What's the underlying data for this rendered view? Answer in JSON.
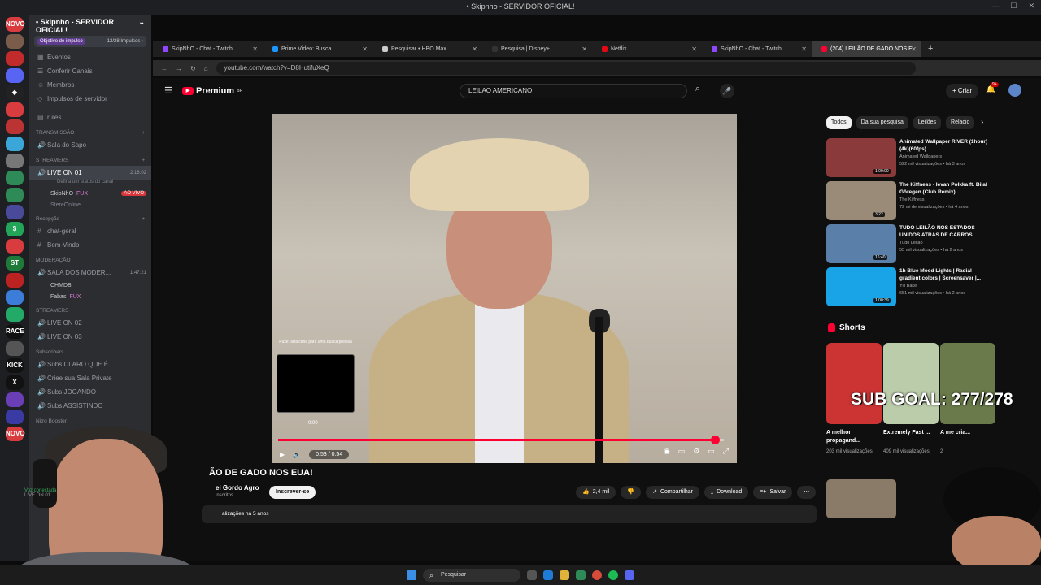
{
  "window": {
    "title": "• Skipnho - SERVIDOR OFICIAL!"
  },
  "discord": {
    "server_title": "• Skipnho - SERVIDOR OFICIAL!",
    "boost_label": "Objetivo de impulso",
    "boost_count": "12/28 Impulsos ›",
    "servers": [
      {
        "label": "NOVO",
        "color": "#d83c3e"
      },
      {
        "label": "",
        "color": "#7a5c4b"
      },
      {
        "label": "",
        "color": "#c22b2b"
      },
      {
        "label": "",
        "color": "#5865f2"
      },
      {
        "label": "◆",
        "color": "#222"
      },
      {
        "label": "",
        "color": "#d83c3e"
      },
      {
        "label": "",
        "color": "#b33"
      },
      {
        "label": "",
        "color": "#3aa7d8"
      },
      {
        "label": "",
        "color": "#777"
      },
      {
        "label": "",
        "color": "#2e8b57"
      },
      {
        "label": "",
        "color": "#2e8b57"
      },
      {
        "label": "",
        "color": "#4a4a9a"
      },
      {
        "label": "$",
        "color": "#23a559"
      },
      {
        "label": "",
        "color": "#d83c3e"
      },
      {
        "label": "ST",
        "color": "#1f7a3a"
      },
      {
        "label": "",
        "color": "#b22"
      },
      {
        "label": "",
        "color": "#3b7dd8"
      },
      {
        "label": "",
        "color": "#2a6"
      },
      {
        "label": "RACE",
        "color": "#111"
      },
      {
        "label": "",
        "color": "#555"
      },
      {
        "label": "KICK",
        "color": "#111"
      },
      {
        "label": "X",
        "color": "#111"
      },
      {
        "label": "",
        "color": "#6a3fb5"
      },
      {
        "label": "",
        "color": "#3a3aa5"
      },
      {
        "label": "NOVO",
        "color": "#d83c3e"
      }
    ],
    "top_items": [
      "Eventos",
      "Conferir Canais",
      "Membros",
      "Impulsos de servidor"
    ],
    "rules": "rules",
    "cat_transmissao": "TRANSMISSÃO",
    "sala_sapo": "Sala do Sapo",
    "cat_streamers": "STREAMERS",
    "live_on_01": "LIVE ON 01",
    "live_on_01_time": "2:16:02",
    "live_status": "Defina um status do canal",
    "user1": "SkipNhO",
    "user1_tag": "FUX",
    "user1_badge": "AO VIVO",
    "user2": "StereOnline",
    "cat_recepcao": "Recepção",
    "chat_geral": "chat-geral",
    "bem_vindo": "Bem-Vindo",
    "cat_moderacao": "MODERAÇÃO",
    "sala_mod": "SALA DOS MODER...",
    "sala_mod_time": "1:47:21",
    "mod1": "CHMDBr",
    "mod2": "Fabas",
    "mod2_tag": "FUX",
    "cat_streamers2": "STREAMERS",
    "live_on_02": "LIVE ON 02",
    "live_on_03": "LIVE ON 03",
    "cat_subscribers": "Subscribers",
    "sub1": "Subs CLARO QUE É",
    "sub2": "Criee sua Sala Private",
    "sub3": "Subs JOGANDO",
    "sub4": "Subs ASSISTINDO",
    "cat_nitro": "Nitro Booster",
    "voice_status": "Voz conectada",
    "voice_channel": "LIVE ON 01"
  },
  "browser": {
    "tabs": [
      {
        "label": "SkipNhO - Chat - Twitch",
        "color": "#9146ff"
      },
      {
        "label": "Prime Video: Busca",
        "color": "#1a98ff"
      },
      {
        "label": "Pesquisar • HBO Max",
        "color": "#ccc"
      },
      {
        "label": "Pesquisa | Disney+",
        "color": "#333"
      },
      {
        "label": "Netflix",
        "color": "#e50914"
      },
      {
        "label": "SkipNhO - Chat - Twitch",
        "color": "#9146ff"
      },
      {
        "label": "(204) LEILÃO DE GADO NOS E...",
        "color": "#ff0033"
      }
    ],
    "url": "youtube.com/watch?v=D8HutifuXeQ"
  },
  "youtube": {
    "logo": "Premium",
    "logo_sup": "BR",
    "search_value": "LEILAO AMERICANO",
    "create_label": "Criar",
    "notif_count": "9+",
    "video": {
      "scrub_tip": "Puxe para cima para uma busca precisa",
      "preview_time": "0:00",
      "time": "0:53 / 0:54",
      "progress_fraction": 0.98
    },
    "title": "ÃO DE GADO NOS EUA!",
    "channel": "ei Gordo Agro",
    "subs": "inscritos",
    "subscribe": "Inscrever-se",
    "likes": "2,4 mil",
    "share": "Compartilhar",
    "download": "Download",
    "save": "Salvar",
    "views": "alizações há 5 anos",
    "chips": [
      "Todos",
      "Da sua pesquisa",
      "Leilões",
      "Relacio"
    ],
    "recs": [
      {
        "title": "Animated Wallpaper RIVER (1hour)(4k)(60fps)",
        "channel": "Animated Wallpapers",
        "views": "522 mil visualizações • há 3 anos",
        "dur": "1:00:00",
        "color": "#8a3a3a"
      },
      {
        "title": "The Kiffness - Ievan Polkka ft. Bilal Göregen (Club Remix) ...",
        "channel": "The Kiffness",
        "views": "72 mi de visualizações • há 4 anos",
        "dur": "3:22",
        "color": "#9a8a78"
      },
      {
        "title": "TUDO LEILÃO NOS ESTADOS UNIDOS ATRÁS DE CARROS ...",
        "channel": "Tudo Leilão",
        "views": "55 mil visualizações • há 2 anos",
        "dur": "16:40",
        "color": "#5a7fa8"
      },
      {
        "title": "1h Blue Mood Lights | Radial gradient colors | Screensaver |...",
        "channel": "Yill Bake",
        "views": "651 mil visualizações • há 2 anos",
        "dur": "1:00:39",
        "color": "#1aa4e8"
      }
    ],
    "shorts_title": "Shorts",
    "shorts": [
      {
        "title": "A melhor propagand...",
        "views": "203 mil visualizações",
        "color": "#c33"
      },
      {
        "title": "Extremely Fast ...",
        "views": "409 mil visualizações",
        "color": "#bca"
      },
      {
        "title": "A me cria...",
        "views": "2",
        "color": "#6a7a4a"
      }
    ]
  },
  "overlay": {
    "sub_goal": "SUB GOAL: 277/278"
  },
  "taskbar": {
    "search": "Pesquisar"
  }
}
